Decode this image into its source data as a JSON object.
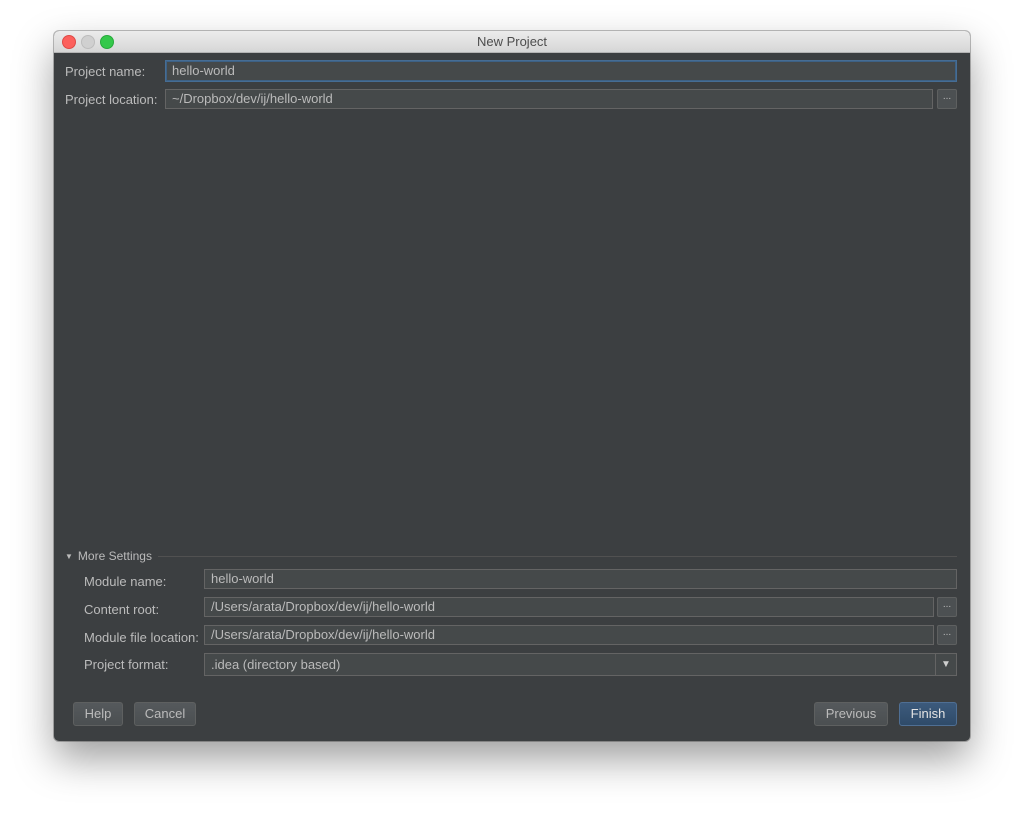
{
  "window": {
    "title": "New Project",
    "controls": [
      "close-icon",
      "minimize-icon",
      "maximize-icon"
    ]
  },
  "project": {
    "name_label": "Project name:",
    "name_value": "hello-world",
    "location_label": "Project location:",
    "location_value": "~/Dropbox/dev/ij/hello-world",
    "browse_label": "..."
  },
  "more_settings": {
    "header": "More Settings",
    "expanded": true,
    "module_name_label": "Module name:",
    "module_name_value": "hello-world",
    "content_root_label": "Content root:",
    "content_root_value": "/Users/arata/Dropbox/dev/ij/hello-world",
    "module_file_label": "Module file location:",
    "module_file_value": "/Users/arata/Dropbox/dev/ij/hello-world",
    "format_label": "Project format:",
    "format_value": ".idea (directory based)",
    "browse_label": "..."
  },
  "buttons": {
    "help": "Help",
    "cancel": "Cancel",
    "previous": "Previous",
    "finish": "Finish"
  },
  "colors": {
    "background": "#3c3f41",
    "field": "#45494a",
    "focus_border": "#466d94",
    "primary_button": "#365880",
    "text": "#bbbbbb"
  }
}
